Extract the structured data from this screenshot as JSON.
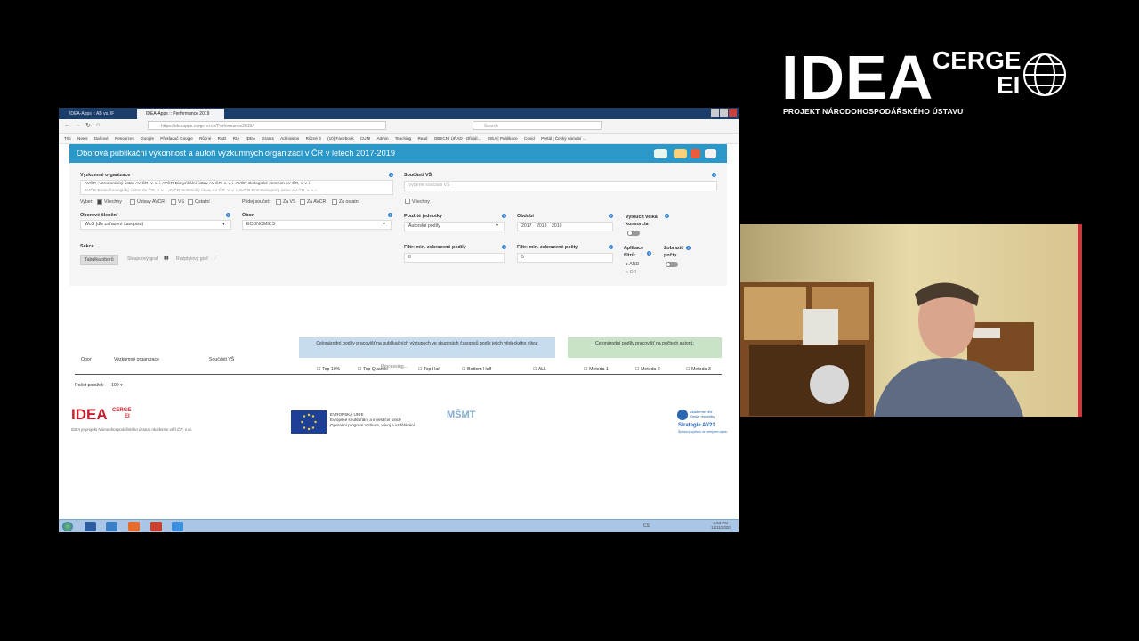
{
  "logo": {
    "name": "IDEA",
    "sub1": "CERGE",
    "sub2": "EI",
    "tagline": "PROJEKT NÁRODOHOSPODÁŘSKÉHO ÚSTAVU"
  },
  "browser": {
    "tabs": [
      "IDEA-Apps :: AB vs. IF",
      "IDEA-Apps :: Performance 2019"
    ],
    "url": "https://ideaapps.cerge-ei.cz/Performance2019/",
    "search_placeholder": "Search",
    "bookmarks": [
      "Trip",
      "News",
      "Daňové",
      "Resources",
      "Google",
      "Překladač Google",
      "Různé",
      "R&D",
      "RIA",
      "IDEA",
      "Grants",
      "Admission",
      "Různé 3",
      "(10) Facebook",
      "CUNI",
      "Admin",
      "Teaching",
      "Read",
      "OBECNÍ ÚŘAD - Oficiál...",
      "IDEA | Publikace",
      "Covid",
      "Portál | Český národní ..."
    ]
  },
  "app": {
    "title": "Oborová publikační výkonnost a autoři výzkumných organizací v ČR v letech 2017-2019",
    "research_orgs_label": "Výzkumné organizace",
    "research_orgs_value1": "AVČR-Astronomický ústav AV ČR, v. v. i.   AVČR-Biofyzikální ústav AV ČR, v. v. i.   AVČR-Biologické centrum AV ČR, v. v. i.",
    "research_orgs_value2": "AVČR-Biotechnologický ústav AV ČR, v. v. i.   AVČR-Botanický ústav AV ČR, v. v. i.   AVČR-Entomologický ústav AV ČR, v. v. i.",
    "select_label": "Vyber:",
    "select_options": [
      "Všechny",
      "Ústavy AVČR",
      "VŠ",
      "Ostatní"
    ],
    "add_label": "Přidej součet:",
    "add_options": [
      "Za VŠ",
      "Za AVČR",
      "Za ostatní"
    ],
    "field_division_label": "Oborové členění",
    "field_division_value": "WoS (dle zařazení časopisu)",
    "field_label": "Obor",
    "field_value": "ECONOMICS",
    "parts_label": "Součásti VŠ",
    "parts_placeholder": "Vyberte součásti VŠ",
    "all_label": "Všechny",
    "units_label": "Použité jednotky",
    "units_value": "Autorské podíly",
    "period_label": "Období",
    "period_values": [
      "2017",
      "2018",
      "2019"
    ],
    "exclude_label": "Vyloučit velká konsorcia",
    "section_label": "Sekce",
    "section_buttons": [
      "Tabulka oborů",
      "Sloupcový graf",
      "Rozptylový graf"
    ],
    "min_share_label": "Filtr: min. zobrazené podíly",
    "min_share_value": "0",
    "min_count_label": "Filtr: min. zobrazené počty",
    "min_count_value": "5",
    "apply_label": "Aplikace filtrů:",
    "apply_options": [
      "AND",
      "OR"
    ],
    "show_counts_label": "Zobrazit počty"
  },
  "table": {
    "group_a": "Celonárodní podíly pracovišť na publikačních výstupech ve skupinách časopisů podle jejich vědeckého vlivu:",
    "group_b": "Celonárodní podíly pracovišť na počtech autorů:",
    "columns": [
      "Obor",
      "Výzkumné organizace",
      "Součásti VŠ"
    ],
    "group_a_columns": [
      "Top 10%",
      "Top Quartile",
      "Top Half",
      "Bottom Half",
      "ALL"
    ],
    "group_b_columns": [
      "Metoda 1",
      "Metoda 2",
      "Metoda 3"
    ],
    "processing": "Processing...",
    "page_size_label": "Počet položek",
    "page_size_value": "100"
  },
  "footer": {
    "idea_note": "IDEA je projekt Národohospodářského ústavu Akademie věd ČR, v.v.i.",
    "eu_text1": "EVROPSKÁ UNIE",
    "eu_text2": "Evropské strukturální a investiční fondy",
    "eu_text3": "Operační program Výzkum, vývoj a vzdělávání",
    "msmt": "MŠMT",
    "av_text1": "Akademie věd",
    "av_text2": "České republiky",
    "av_strategy": "Strategie AV21",
    "av_text3": "Špičkový výzkum ve veřejném zájmu"
  },
  "taskbar": {
    "time": "2:53 PM",
    "date": "12/11/2020",
    "lang": "CS"
  }
}
